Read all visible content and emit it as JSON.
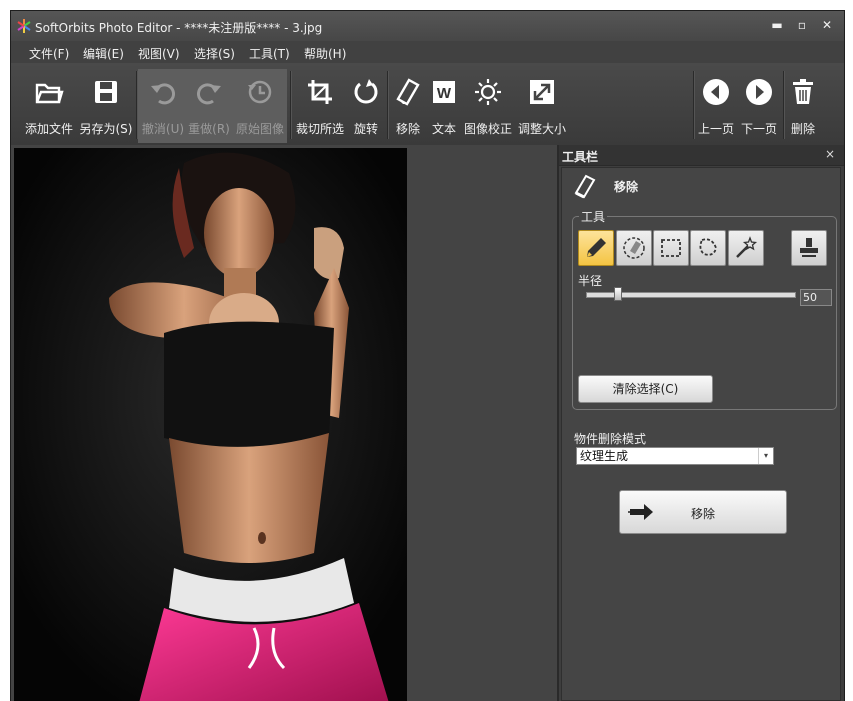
{
  "window": {
    "title": "SoftOrbits Photo Editor - ****未注册版**** - 3.jpg",
    "controls": {
      "minimize": "▬",
      "maximize": "▫",
      "close": "✕"
    }
  },
  "menu": {
    "items": [
      {
        "label": "文件(F)"
      },
      {
        "label": "编辑(E)"
      },
      {
        "label": "视图(V)"
      },
      {
        "label": "选择(S)"
      },
      {
        "label": "工具(T)"
      },
      {
        "label": "帮助(H)"
      }
    ]
  },
  "toolbar": {
    "add_file": "添加文件",
    "save_as": "另存为(S)",
    "undo": "撤消(U)",
    "redo": "重做(R)",
    "original": "原始图像",
    "crop": "裁切所选",
    "rotate": "旋转",
    "remove": "移除",
    "text": "文本",
    "correct": "图像校正",
    "resize": "调整大小",
    "prev": "上一页",
    "next": "下一页",
    "delete": "删除",
    "text_icon_letter": "W"
  },
  "panel": {
    "title": "工具栏",
    "close": "×",
    "mode_title": "移除",
    "tools_group_label": "工具",
    "radius_label": "半径",
    "radius_value": "50",
    "radius_fraction": 0.15,
    "clear_selection": "清除选择(C)",
    "removal_mode_label": "物件删除模式",
    "removal_mode_value": "纹理生成",
    "remove_button": "移除"
  },
  "colors": {
    "background": "#3c3c3c",
    "active_tool": "#f4c443",
    "photo_accent": "#e0207a"
  }
}
